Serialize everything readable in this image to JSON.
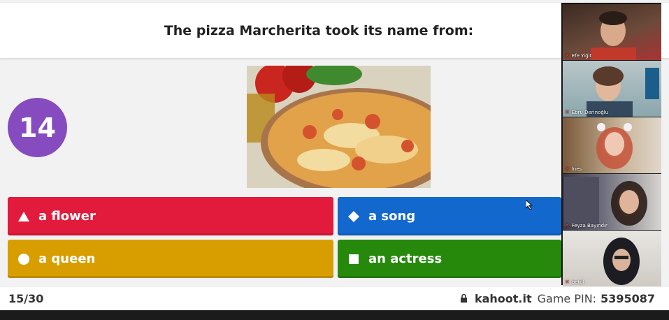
{
  "question": {
    "text": "The pizza Marcherita took its name from:"
  },
  "counter": {
    "value": "14"
  },
  "colors": {
    "red": "#e21b3c",
    "blue": "#1368ce",
    "yellow": "#d89e00",
    "green": "#26890c",
    "purple": "#864cbf"
  },
  "answers": [
    {
      "label": "a flower",
      "icon": "triangle-icon"
    },
    {
      "label": "a song",
      "icon": "diamond-icon"
    },
    {
      "label": "a queen",
      "icon": "circle-icon"
    },
    {
      "label": "an actress",
      "icon": "square-icon"
    }
  ],
  "footer": {
    "progress": "15/30",
    "site": "kahoot.it",
    "pin_label": "Game PIN:",
    "pin": "5395087"
  },
  "participants": [
    {
      "name": "Efe Yiğit"
    },
    {
      "name": "Ebru Derinoğlu"
    },
    {
      "name": "İnes"
    },
    {
      "name": "Feyza Bayındır"
    },
    {
      "name": "betül"
    }
  ]
}
